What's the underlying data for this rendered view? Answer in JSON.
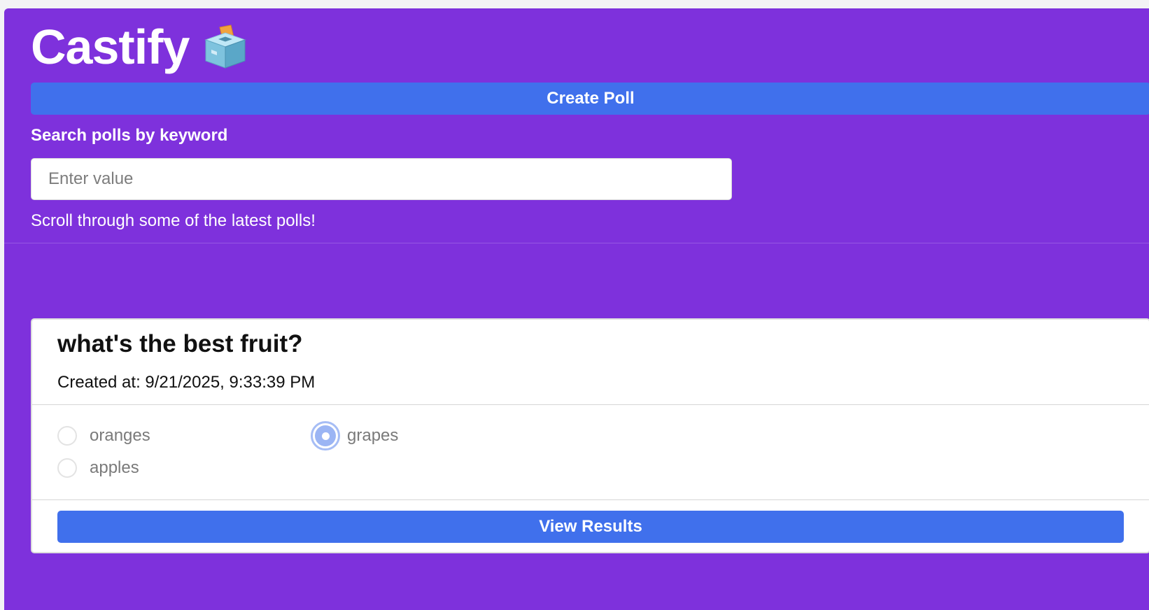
{
  "app": {
    "title": "Castify",
    "logo_icon": "ballot-box-icon"
  },
  "header": {
    "create_label": "Create Poll",
    "search_label": "Search polls by keyword",
    "search_placeholder": "Enter value",
    "search_value": "",
    "subtitle": "Scroll through some of the latest polls!"
  },
  "poll": {
    "title": "what's the best fruit?",
    "created": "Created at: 9/21/2025, 9:33:39 PM",
    "options": [
      {
        "label": "oranges",
        "selected": false
      },
      {
        "label": "apples",
        "selected": false
      },
      {
        "label": "grapes",
        "selected": true
      }
    ],
    "results_label": "View Results"
  },
  "colors": {
    "background": "#7e31dc",
    "primary_button": "#4070ec",
    "card": "#ffffff",
    "selected_radio": "#9bb5f4"
  }
}
